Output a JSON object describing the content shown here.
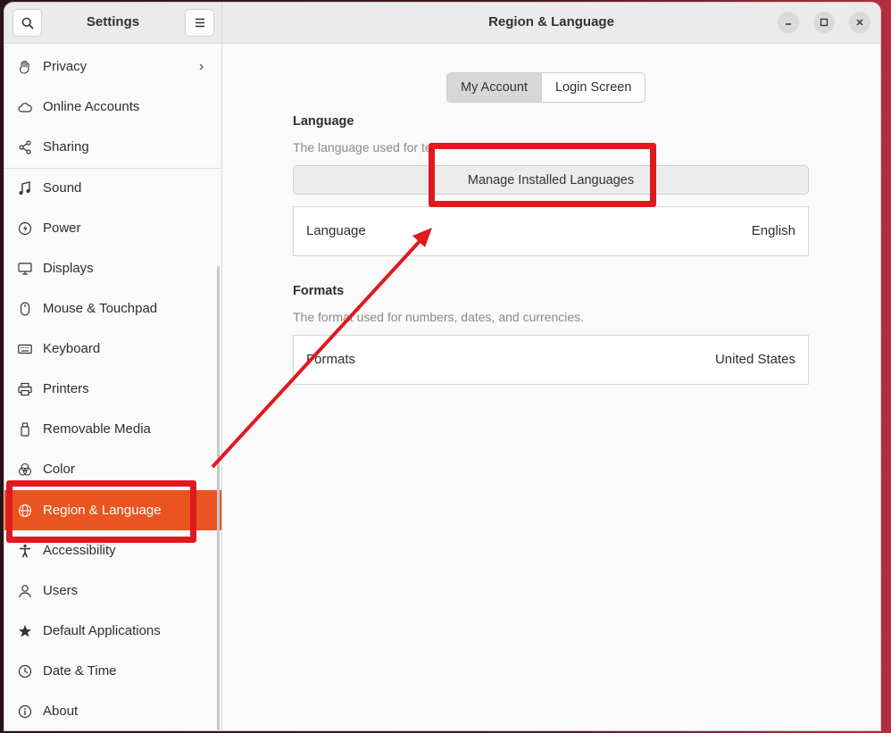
{
  "sidebar": {
    "title": "Settings",
    "items": [
      {
        "label": "Privacy",
        "icon": "hand-icon"
      },
      {
        "label": "Online Accounts",
        "icon": "cloud-icon"
      },
      {
        "label": "Sharing",
        "icon": "share-icon"
      },
      {
        "label": "Sound",
        "icon": "music-note-icon"
      },
      {
        "label": "Power",
        "icon": "power-icon"
      },
      {
        "label": "Displays",
        "icon": "display-icon"
      },
      {
        "label": "Mouse & Touchpad",
        "icon": "mouse-icon"
      },
      {
        "label": "Keyboard",
        "icon": "keyboard-icon"
      },
      {
        "label": "Printers",
        "icon": "printer-icon"
      },
      {
        "label": "Removable Media",
        "icon": "usb-icon"
      },
      {
        "label": "Color",
        "icon": "color-icon"
      },
      {
        "label": "Region & Language",
        "icon": "globe-icon"
      },
      {
        "label": "Accessibility",
        "icon": "accessibility-icon"
      },
      {
        "label": "Users",
        "icon": "users-icon"
      },
      {
        "label": "Default Applications",
        "icon": "star-icon"
      },
      {
        "label": "Date & Time",
        "icon": "clock-icon"
      },
      {
        "label": "About",
        "icon": "info-icon"
      }
    ],
    "active_item": "Region & Language"
  },
  "header": {
    "title": "Region & Language"
  },
  "tabs": [
    {
      "label": "My Account",
      "selected": true
    },
    {
      "label": "Login Screen",
      "selected": false
    }
  ],
  "language_section": {
    "title": "Language",
    "description": "The language used for text in windows and web pages.",
    "manage_button": "Manage Installed Languages",
    "row_label": "Language",
    "row_value": "English"
  },
  "formats_section": {
    "title": "Formats",
    "description": "The format used for numbers, dates, and currencies.",
    "row_label": "Formats",
    "row_value": "United States"
  },
  "colors": {
    "accent": "#e95420",
    "annotation": "#e0191f"
  }
}
